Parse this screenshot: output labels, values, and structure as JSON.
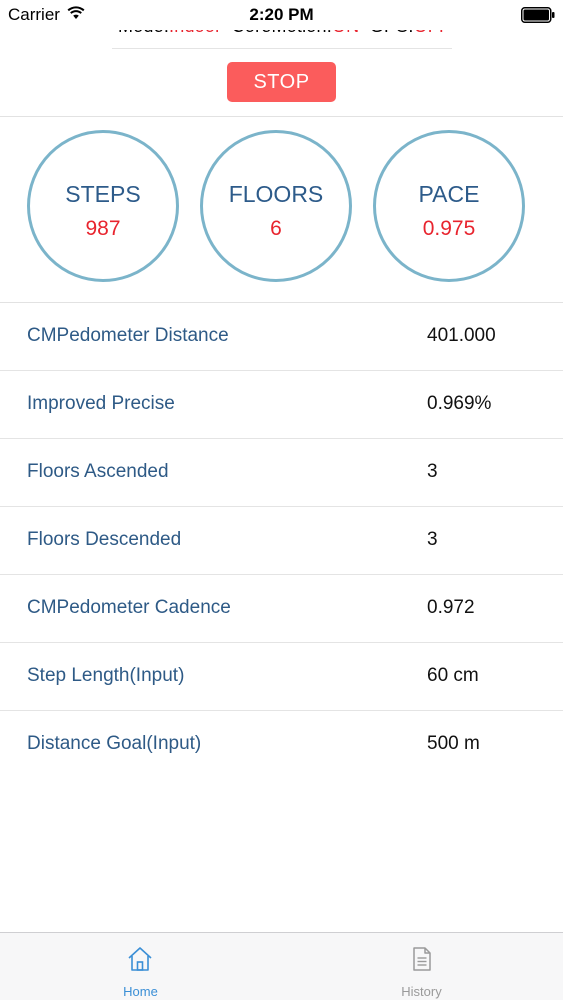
{
  "status_bar": {
    "carrier": "Carrier",
    "time": "2:20 PM"
  },
  "mode_line": {
    "mode_label": "Mode:",
    "mode_value": "Indoor",
    "coremotion_label": "CoreMotion:",
    "coremotion_value": "ON",
    "gps_label": "GPS:",
    "gps_value": "OFF"
  },
  "stop_button": {
    "label": "STOP"
  },
  "stats": [
    {
      "title": "STEPS",
      "value": "987"
    },
    {
      "title": "FLOORS",
      "value": "6"
    },
    {
      "title": "PACE",
      "value": "0.975"
    }
  ],
  "table": {
    "rows": [
      {
        "label": "CMPedometer Distance",
        "value": "401.000"
      },
      {
        "label": "Improved Precise",
        "value": "0.969%"
      },
      {
        "label": "Floors Ascended",
        "value": "3"
      },
      {
        "label": "Floors Descended",
        "value": "3"
      },
      {
        "label": "CMPedometer Cadence",
        "value": "0.972"
      },
      {
        "label": "Step Length(Input)",
        "value": "60 cm"
      },
      {
        "label": "Distance Goal(Input)",
        "value": "500 m"
      }
    ]
  },
  "tab_bar": {
    "tabs": [
      {
        "label": "Home",
        "icon": "home-icon",
        "selected": true
      },
      {
        "label": "History",
        "icon": "document-icon",
        "selected": false
      }
    ]
  },
  "colors": {
    "accent_red": "#e8242e",
    "stop_button": "#fb5c5c",
    "circle_border": "#7bb4ca",
    "label_blue": "#2e5a86",
    "tab_selected": "#3b8fd6",
    "tab_unselected": "#9a9a9a"
  }
}
